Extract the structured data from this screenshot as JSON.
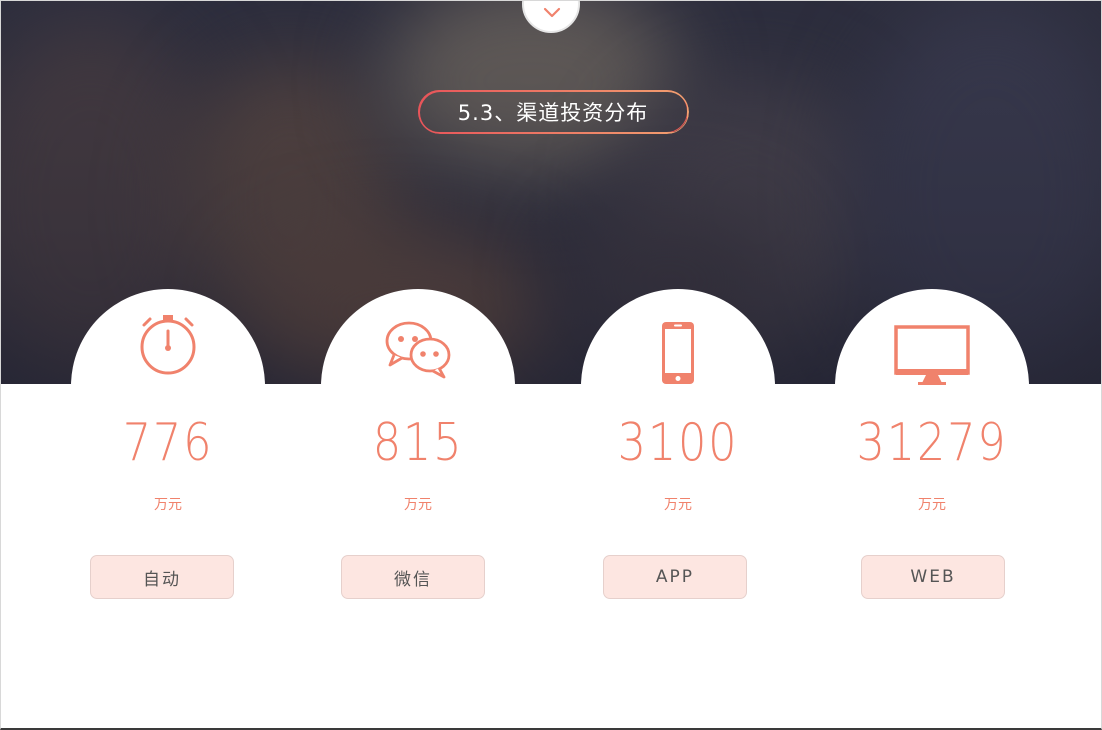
{
  "header": {
    "title": "5.3、渠道投资分布"
  },
  "accent_color": "#f0826c",
  "channels": [
    {
      "icon": "stopwatch-icon",
      "value": "776",
      "unit": "万元",
      "label": "自动"
    },
    {
      "icon": "wechat-icon",
      "value": "815",
      "unit": "万元",
      "label": "微信"
    },
    {
      "icon": "smartphone-icon",
      "value": "3100",
      "unit": "万元",
      "label": "APP"
    },
    {
      "icon": "monitor-icon",
      "value": "31279",
      "unit": "万元",
      "label": "WEB"
    }
  ]
}
